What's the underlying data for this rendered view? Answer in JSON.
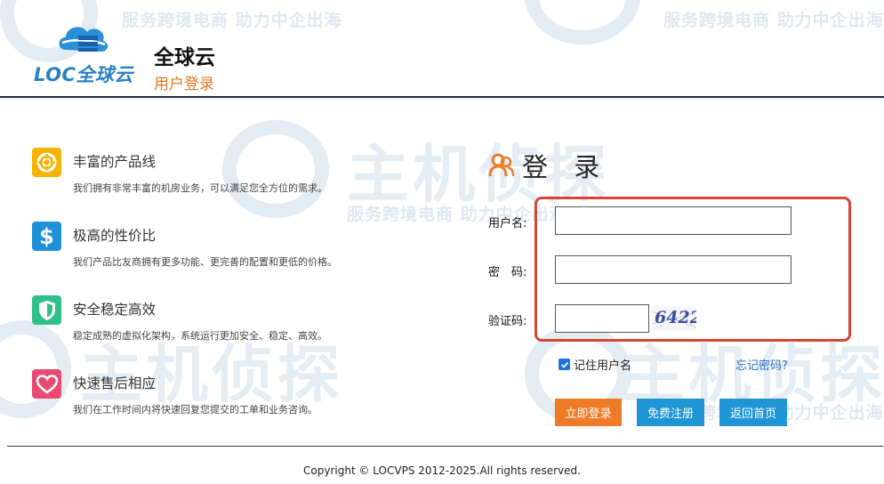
{
  "watermark": {
    "slogan": "服务跨境电商 助力中企出海",
    "brand": "主机侦探"
  },
  "header": {
    "logo_text": "LOC全球云",
    "title": "全球云",
    "subtitle": "用户登录"
  },
  "features": [
    {
      "title": "丰富的产品线",
      "desc": "我们拥有非常丰富的机房业务，可以满足您全方位的需求。",
      "icon": "lifebuoy-icon",
      "color": "#f7b300"
    },
    {
      "title": "极高的性价比",
      "desc": "我们产品比友商拥有更多功能、更完善的配置和更低的价格。",
      "icon": "dollar-icon",
      "color": "#1f8fd8"
    },
    {
      "title": "安全稳定高效",
      "desc": "稳定成熟的虚拟化架构，系统运行更加安全、稳定、高效。",
      "icon": "shield-icon",
      "color": "#2fbf8a"
    },
    {
      "title": "快速售后相应",
      "desc": "我们在工作时间内将快速回复您提交的工单和业务咨询。",
      "icon": "heart-icon",
      "color": "#e94a73"
    }
  ],
  "login": {
    "title": "登 录",
    "username_label": "用户名:",
    "password_label": "密　码:",
    "captcha_label": "验证码:",
    "username_value": "",
    "password_value": "",
    "captcha_value": "",
    "captcha_image_text": "6422",
    "remember_label": "记住用户名",
    "remember_checked": true,
    "forgot_label": "忘记密码?",
    "login_button": "立即登录",
    "register_button": "免费注册",
    "home_button": "返回首页"
  },
  "footer": {
    "copyright": "Copyright © LOCVPS 2012-2025.All rights reserved."
  },
  "colors": {
    "accent_orange": "#ef7b27",
    "accent_blue": "#1f95d6",
    "highlight_red": "#d64535"
  }
}
